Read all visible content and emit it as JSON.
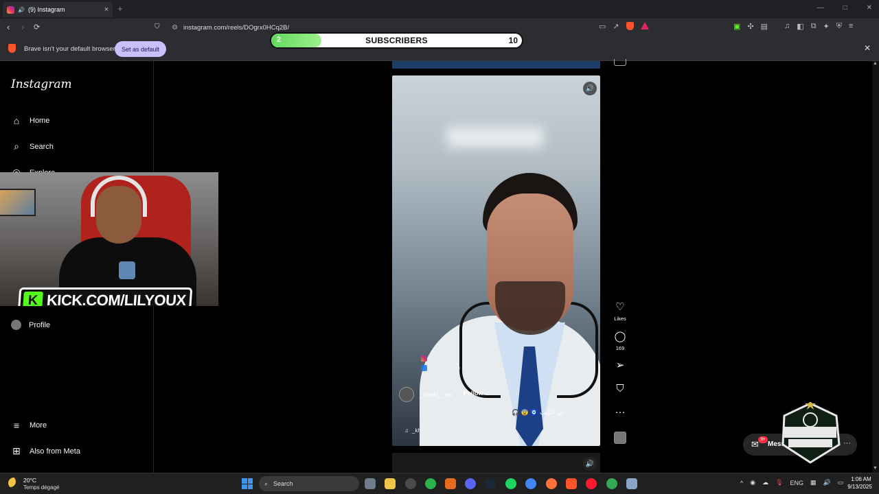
{
  "browser": {
    "tab_title": "(9) Instagram",
    "tab_close": "×",
    "new_tab": "+",
    "url": "instagram.com/reels/DOgrx0HCq2B/",
    "window_controls": [
      "—",
      "□",
      "✕"
    ]
  },
  "infobar": {
    "message": "Brave isn't your default browser",
    "button": "Set as default",
    "close": "✕"
  },
  "subscribers": {
    "current": "2",
    "label": "SUBSCRIBERS",
    "goal": "10",
    "progress_fraction": 0.2
  },
  "instagram": {
    "logo": "Instagram",
    "nav": [
      {
        "label": "Home",
        "icon": "home-icon"
      },
      {
        "label": "Search",
        "icon": "search-icon"
      },
      {
        "label": "Explore",
        "icon": "explore-icon"
      },
      {
        "label": "Profile",
        "icon": "profile-avatar"
      },
      {
        "label": "More",
        "icon": "menu-icon"
      },
      {
        "label": "Also from Meta",
        "icon": "meta-icon"
      }
    ]
  },
  "stream": {
    "kick_url": "KICK.COM/LILYOUX"
  },
  "reel": {
    "watermark_ig": "_khalid__elk",
    "watermark_fb": "khalid elk 2.0",
    "author": "_khalid__elk",
    "follow": "Follow",
    "caption": "دير الكيت 🧿 😨 🎧",
    "audio": "_khalid__elk · Original audio",
    "likes_label": "Likes",
    "comments_count": "169"
  },
  "messages": {
    "label": "Messages",
    "badge": "9+"
  },
  "taskbar": {
    "temp": "20°C",
    "weather": "Temps dégagé",
    "search": "Search",
    "language": "ENG",
    "time": "1:06 AM",
    "date": "9/13/2025"
  },
  "colors": {
    "kick_green": "#53fc18",
    "subs_fill": "#61d85c",
    "set_default_bg": "#c8bffc"
  }
}
